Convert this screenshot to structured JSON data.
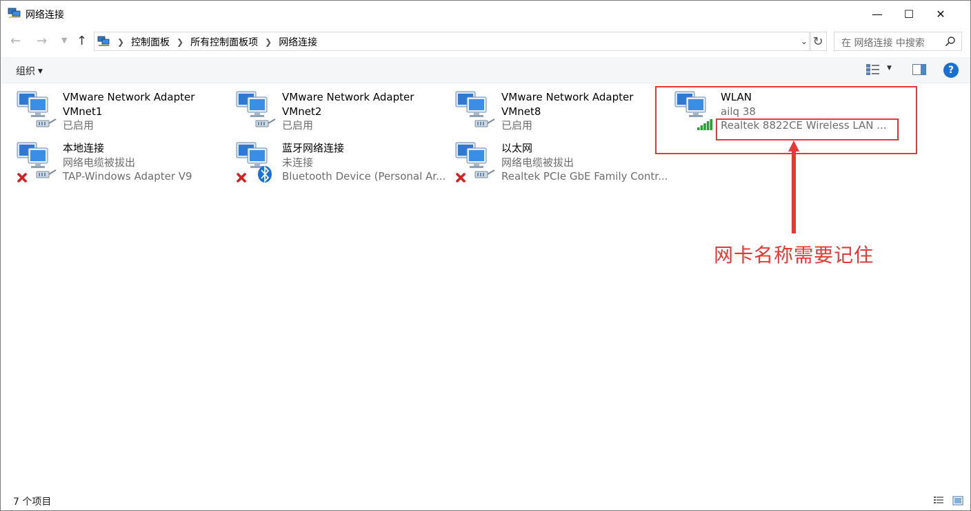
{
  "window": {
    "title": "网络连接",
    "minimize_glyph": "—",
    "maximize_glyph": "☐",
    "close_glyph": "✕"
  },
  "nav": {
    "back_glyph": "←",
    "forward_glyph": "→",
    "up_glyph": "↑",
    "refresh_glyph": "↻",
    "breadcrumbs": [
      "控制面板",
      "所有控制面板项",
      "网络连接"
    ],
    "search_placeholder": "在 网络连接 中搜索"
  },
  "toolbar": {
    "organize_label": "组织",
    "help_label": "?"
  },
  "items": [
    {
      "name": "VMware Network Adapter",
      "name2": "VMnet1",
      "status": "已启用",
      "device": "",
      "icon": "network-adapter-icon",
      "state": "enabled"
    },
    {
      "name": "VMware Network Adapter",
      "name2": "VMnet2",
      "status": "已启用",
      "device": "",
      "icon": "network-adapter-icon",
      "state": "enabled"
    },
    {
      "name": "VMware Network Adapter",
      "name2": "VMnet8",
      "status": "已启用",
      "device": "",
      "icon": "network-adapter-icon",
      "state": "enabled"
    },
    {
      "name": "WLAN",
      "name2": "",
      "status": "ailq 38",
      "device": "Realtek 8822CE Wireless LAN ...",
      "icon": "wlan-adapter-icon",
      "state": "connected"
    },
    {
      "name": "本地连接",
      "name2": "",
      "status": "网络电缆被拔出",
      "device": "TAP-Windows Adapter V9",
      "icon": "network-adapter-icon",
      "state": "disconnected"
    },
    {
      "name": "蓝牙网络连接",
      "name2": "",
      "status": "未连接",
      "device": "Bluetooth Device (Personal Ar...",
      "icon": "bluetooth-adapter-icon",
      "state": "disconnected"
    },
    {
      "name": "以太网",
      "name2": "",
      "status": "网络电缆被拔出",
      "device": "Realtek PCIe GbE Family Contr...",
      "icon": "network-adapter-icon",
      "state": "disconnected"
    }
  ],
  "annotation": {
    "text": "网卡名称需要记住",
    "color": "#e53935"
  },
  "status_bar": {
    "count_text": "7 个项目"
  },
  "colors": {
    "accent": "#1a6fd0",
    "annotation_red": "#e53935",
    "secondary_text": "#6d6d6d"
  }
}
